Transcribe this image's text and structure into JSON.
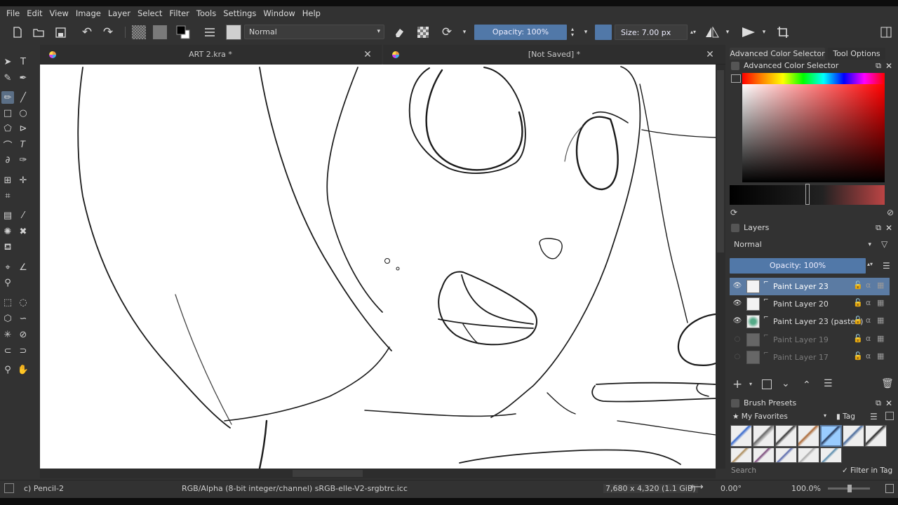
{
  "menu": [
    "File",
    "Edit",
    "View",
    "Image",
    "Layer",
    "Select",
    "Filter",
    "Tools",
    "Settings",
    "Window",
    "Help"
  ],
  "toolbar": {
    "blend_mode": "Normal",
    "opacity_label": "Opacity: 100%",
    "size_label": "Size: 7.00 px"
  },
  "tabs": [
    {
      "title": "ART 2.kra *"
    },
    {
      "title": "[Not Saved]  *"
    }
  ],
  "dock": {
    "tabs": [
      "Advanced Color Selector",
      "Tool Options"
    ],
    "color_panel_title": "Advanced Color Selector",
    "layers_title": "Layers",
    "layers_blend": "Normal",
    "layers_opacity": "Opacity:  100%",
    "layers": [
      {
        "name": "Paint Layer 23",
        "visible": true,
        "selected": true
      },
      {
        "name": "Paint Layer 20",
        "visible": true,
        "selected": false
      },
      {
        "name": "Paint Layer 23 (pasted)",
        "visible": true,
        "selected": false
      },
      {
        "name": "Paint Layer 19",
        "visible": false,
        "selected": false
      },
      {
        "name": "Paint Layer 17",
        "visible": false,
        "selected": false
      }
    ],
    "brush_presets_title": "Brush Presets",
    "brush_tag": "My Favorites",
    "tag_label": "Tag",
    "search_placeholder": "Search",
    "filter_in_tag": "Filter in Tag"
  },
  "status": {
    "brush": "c) Pencil-2",
    "colorspace": "RGB/Alpha (8-bit integer/channel)  sRGB-elle-V2-srgbtrc.icc",
    "image_size": "7,680 x 4,320 (1.1 GiB)",
    "rotation": "0.00°",
    "zoom": "100.0%"
  },
  "colors": {
    "accent": "#5178a8",
    "selected_layer": "#5b7ba3"
  }
}
